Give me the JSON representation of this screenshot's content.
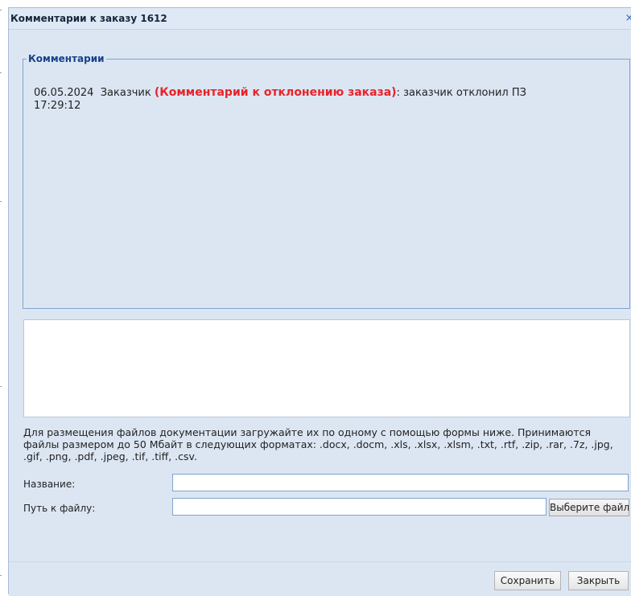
{
  "window": {
    "title": "Комментарии к заказу 1612",
    "close_glyph": "×"
  },
  "comments": {
    "legend": "Комментарии",
    "entries": [
      {
        "date": "06.05.2024",
        "time": "17:29:12",
        "author": "Заказчик",
        "type": "(Комментарий к отклонению заказа)",
        "text": ": заказчик отклонил ПЗ"
      }
    ]
  },
  "new_comment": {
    "value": ""
  },
  "upload": {
    "instructions": "Для размещения файлов документации загружайте их по одному с помощью формы ниже. Принимаются файлы размером до 50 Мбайт в следующих форматах: .docx, .docm, .xls, .xlsx, .xlsm, .txt, .rtf, .zip, .rar, .7z, .jpg, .gif, .png, .pdf, .jpeg, .tif, .tiff, .csv.",
    "name_label": "Название:",
    "name_value": "",
    "path_label": "Путь к файлу:",
    "path_value": "",
    "browse_label": "Выберите файл"
  },
  "footer": {
    "save_label": "Сохранить",
    "close_label": "Закрыть"
  },
  "colors": {
    "window_bg": "#dce6f3",
    "legend_text": "#15428b",
    "comment_type_red": "#e8222a",
    "field_border": "#7ea3cf"
  },
  "icons": {
    "close": "close-icon"
  }
}
